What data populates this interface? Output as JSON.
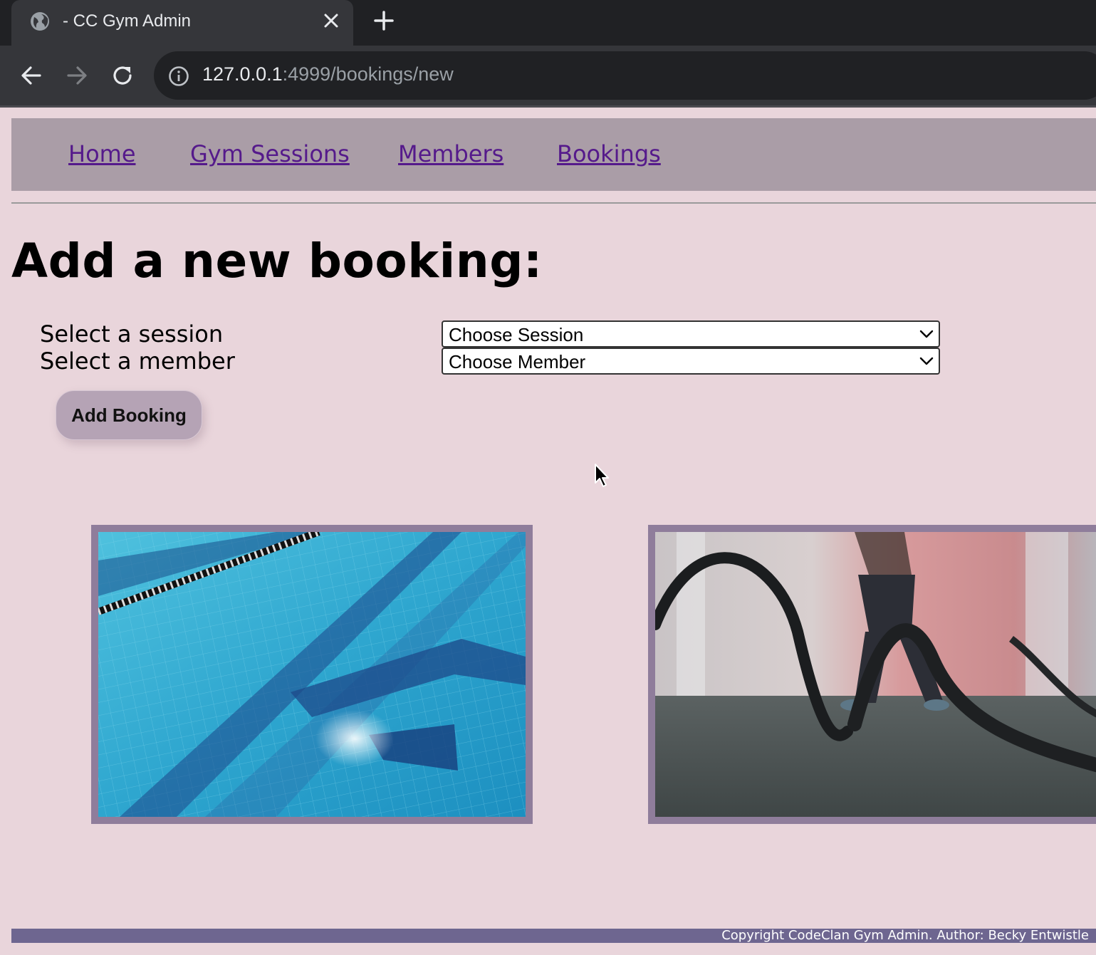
{
  "browser": {
    "tab_title": "- CC Gym Admin",
    "url_host": "127.0.0.1",
    "url_rest": ":4999/bookings/new"
  },
  "nav": {
    "items": [
      {
        "label": "Home"
      },
      {
        "label": "Gym Sessions"
      },
      {
        "label": "Members"
      },
      {
        "label": "Bookings"
      }
    ]
  },
  "form": {
    "heading": "Add a new booking:",
    "session_label": "Select a session",
    "session_value": "Choose Session",
    "member_label": "Select a member",
    "member_value": "Choose Member",
    "submit_label": "Add Booking"
  },
  "footer": {
    "text": "Copyright CodeClan Gym Admin. Author: Becky Entwistle"
  },
  "colors": {
    "page_bg": "#e9d5db",
    "navbar_bg": "#aa9da7",
    "link": "#551a8b",
    "button_bg": "#b5a3b5",
    "frame": "#8f7d9b",
    "footer_bg": "#6e6690"
  }
}
